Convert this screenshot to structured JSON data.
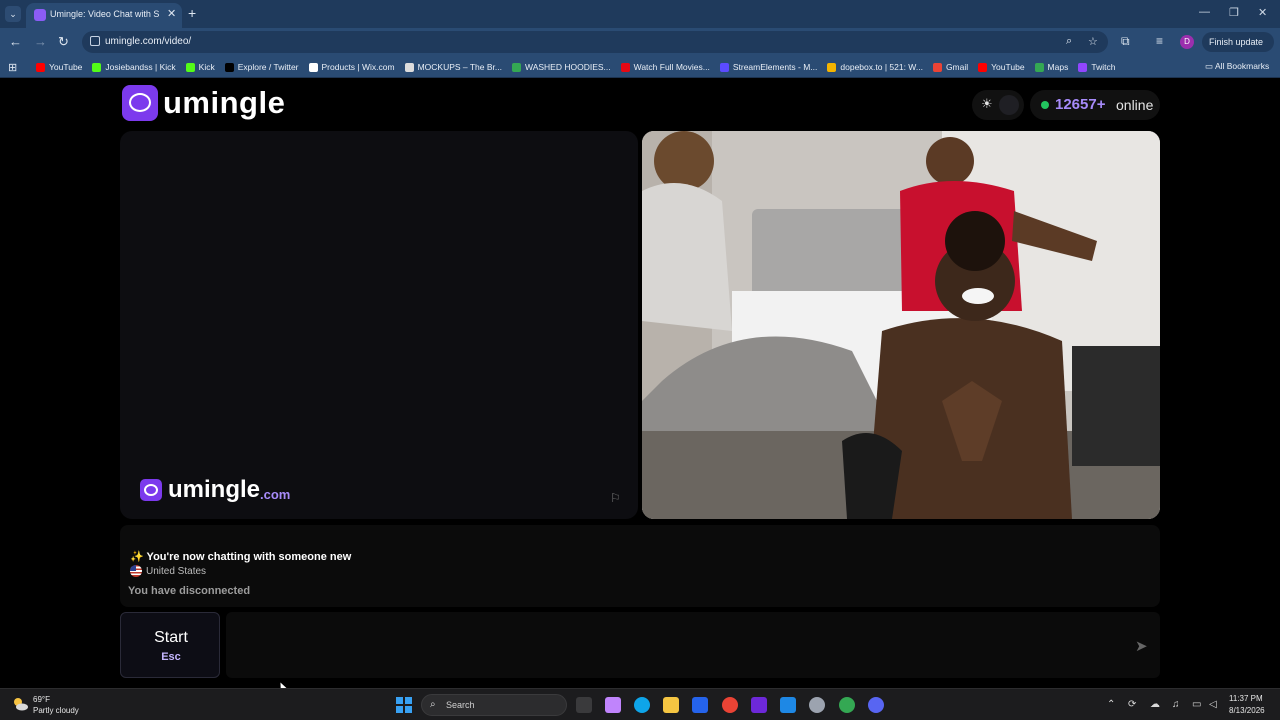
{
  "browser": {
    "tab_title": "Umingle: Video Chat with S",
    "url": "umingle.com/video/",
    "finish_update": "Finish update",
    "profile_initial": "D",
    "all_bookmarks": "All Bookmarks",
    "bookmarks": [
      {
        "label": "YouTube",
        "color": "#ff0000"
      },
      {
        "label": "Josiebandss | Kick",
        "color": "#53fc18"
      },
      {
        "label": "Kick",
        "color": "#53fc18"
      },
      {
        "label": "Explore / Twitter",
        "color": "#000000"
      },
      {
        "label": "Products | Wix.com",
        "color": "#ffffff"
      },
      {
        "label": "MOCKUPS – The Br...",
        "color": "#dddddd"
      },
      {
        "label": "WASHED HOODIES...",
        "color": "#34a853"
      },
      {
        "label": "Watch Full Movies...",
        "color": "#e50914"
      },
      {
        "label": "StreamElements - M...",
        "color": "#5b4bff"
      },
      {
        "label": "dopebox.to | 521: W...",
        "color": "#f4b400"
      },
      {
        "label": "Gmail",
        "color": "#ea4335"
      },
      {
        "label": "YouTube",
        "color": "#ff0000"
      },
      {
        "label": "Maps",
        "color": "#34a853"
      },
      {
        "label": "Twitch",
        "color": "#9146ff"
      }
    ]
  },
  "site": {
    "logo_text": "umingle",
    "online_count": "12657+",
    "online_label": "online",
    "watermark_text": "umingle",
    "watermark_suffix": ".com",
    "accent_color": "#7c3aed"
  },
  "chat": {
    "new_chat_message": "✨ You're now chatting with someone new",
    "country": "United States",
    "status": "You have disconnected",
    "start_label": "Start",
    "start_key": "Esc",
    "input_value": ""
  },
  "taskbar": {
    "temperature": "69°F",
    "weather": "Partly cloudy",
    "search_label": "Search",
    "time": "11:37 PM",
    "date": "8/13/2026"
  }
}
